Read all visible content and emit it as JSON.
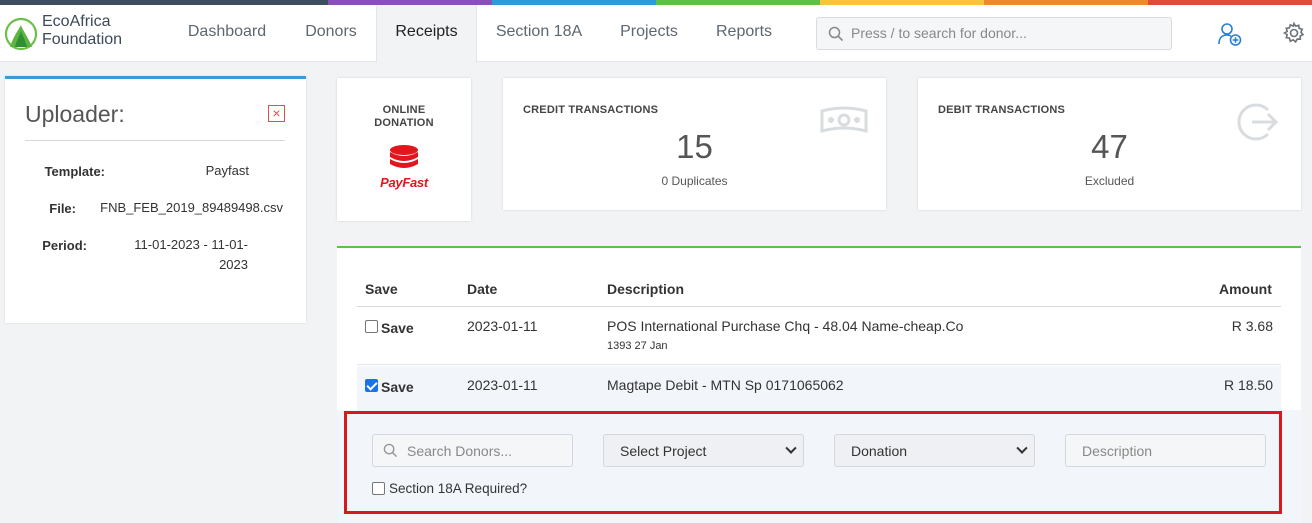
{
  "colors": {
    "strip": [
      "#3c4e5f",
      "#3c4e5f",
      "#8b4fb8",
      "#2d9bd8",
      "#64bd47",
      "#f5c53a",
      "#ef8a2c",
      "#e24b3b"
    ],
    "accent_blue": "#3d9ad6",
    "accent_green": "#5cc04d",
    "highlight_red": "#d8181d",
    "payfast_red": "#e2161c"
  },
  "brand": {
    "line1": "EcoAfrica",
    "line2": "Foundation",
    "icon": "leaf-logo-icon"
  },
  "nav": {
    "tabs": [
      {
        "label": "Dashboard",
        "active": false
      },
      {
        "label": "Donors",
        "active": false
      },
      {
        "label": "Receipts",
        "active": true
      },
      {
        "label": "Section 18A",
        "active": false
      },
      {
        "label": "Projects",
        "active": false
      },
      {
        "label": "Reports",
        "active": false
      }
    ],
    "search_placeholder": "Press / to search for donor...",
    "icons": [
      "add-user-icon",
      "gear-icon"
    ]
  },
  "uploader": {
    "title": "Uploader:",
    "close_icon": "close-icon",
    "fields": [
      {
        "label": "Template:",
        "value": "Payfast"
      },
      {
        "label": "File:",
        "value": "FNB_FEB_2019_89489498.csv"
      },
      {
        "label": "Period:",
        "value_line1": "11-01-2023 - 11-01-",
        "value_line2": "2023"
      }
    ]
  },
  "cards": {
    "online": {
      "line1": "ONLINE",
      "line2": "DONATION",
      "brand": "PayFast"
    },
    "credit": {
      "label": "CREDIT TRANSACTIONS",
      "count": "15",
      "sub": "0 Duplicates",
      "icon": "money-icon"
    },
    "debit": {
      "label": "DEBIT TRANSACTIONS",
      "count": "47",
      "sub": "Excluded",
      "icon": "sign-out-icon"
    }
  },
  "table": {
    "headers": {
      "save": "Save",
      "date": "Date",
      "description": "Description",
      "amount": "Amount"
    },
    "rows": [
      {
        "checked": false,
        "save": "Save",
        "date": "2023-01-11",
        "description": "POS International Purchase Chq - 48.04 Name-cheap.Co",
        "sub": "1393 27 Jan",
        "amount": "R 3.68"
      },
      {
        "checked": true,
        "save": "Save",
        "date": "2023-01-11",
        "description": "Magtape Debit - MTN Sp 0171065062",
        "sub": "",
        "amount": "R 18.50"
      }
    ]
  },
  "assign": {
    "donor_placeholder": "Search Donors...",
    "project_select": "Select Project",
    "type_select": "Donation",
    "description_placeholder": "Description",
    "section18a_label": "Section 18A Required?",
    "section18a_checked": false
  }
}
